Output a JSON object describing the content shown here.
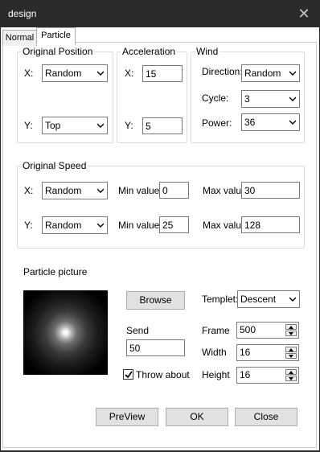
{
  "window": {
    "title": "design"
  },
  "tabs": [
    {
      "label": "Normal"
    },
    {
      "label": "Particle"
    }
  ],
  "original_position": {
    "title": "Original Position",
    "x_label": "X:",
    "x_value": "Random",
    "y_label": "Y:",
    "y_value": "Top"
  },
  "acceleration": {
    "title": "Acceleration",
    "x_label": "X:",
    "x_value": "15",
    "y_label": "Y:",
    "y_value": "5"
  },
  "wind": {
    "title": "Wind",
    "direction_label": "Direction:",
    "direction_value": "Random",
    "cycle_label": "Cycle:",
    "cycle_value": "3",
    "power_label": "Power:",
    "power_value": "36"
  },
  "original_speed": {
    "title": "Original Speed",
    "x_label": "X:",
    "x_value": "Random",
    "x_min_label": "Min value",
    "x_min_value": "0",
    "x_max_label": "Max value",
    "x_max_value": "30",
    "y_label": "Y:",
    "y_value": "Random",
    "y_min_label": "Min value",
    "y_min_value": "25",
    "y_max_label": "Max value",
    "y_max_value": "128"
  },
  "particle_picture": {
    "title": "Particle picture",
    "browse_label": "Browse",
    "send_label": "Send",
    "send_value": "50",
    "throw_about_label": "Throw about",
    "throw_about_checked": true,
    "templet_label": "Templet:",
    "templet_value": "Descent",
    "frame_label": "Frame",
    "frame_value": "500",
    "width_label": "Width",
    "width_value": "16",
    "height_label": "Height",
    "height_value": "16"
  },
  "buttons": {
    "preview": "PreView",
    "ok": "OK",
    "close": "Close"
  },
  "icons": {
    "close": "close-icon",
    "dropdown": "chevron-down-icon",
    "spin_up": "spin-up-icon",
    "spin_down": "spin-down-icon",
    "check": "checkmark-icon"
  },
  "colors": {
    "titlebar": "#2b2b2b",
    "title_text": "#ffffff",
    "button_face": "#e1e1e1"
  }
}
